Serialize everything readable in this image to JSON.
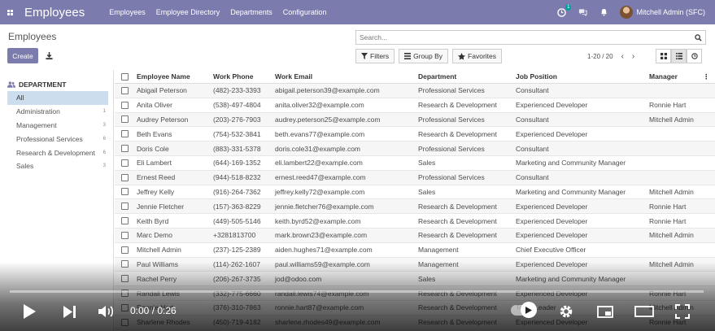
{
  "navbar": {
    "app_title": "Employees",
    "menu": [
      "Employees",
      "Employee Directory",
      "Departments",
      "Configuration"
    ],
    "activity_badge": "1",
    "user_name": "Mitchell Admin (SFC)",
    "accent_color": "#7c7bad"
  },
  "control_panel": {
    "title": "Employees",
    "create_label": "Create",
    "search_placeholder": "Search...",
    "filters_label": "Filters",
    "group_by_label": "Group By",
    "favorites_label": "Favorites",
    "pager": "1-20 / 20"
  },
  "sidebar": {
    "header": "DEPARTMENT",
    "items": [
      {
        "label": "All",
        "count": ""
      },
      {
        "label": "Administration",
        "count": "1"
      },
      {
        "label": "Management",
        "count": "3"
      },
      {
        "label": "Professional Services",
        "count": "6"
      },
      {
        "label": "Research & Development",
        "count": "6"
      },
      {
        "label": "Sales",
        "count": "3"
      }
    ]
  },
  "table": {
    "columns": [
      "Employee Name",
      "Work Phone",
      "Work Email",
      "Department",
      "Job Position",
      "Manager"
    ],
    "rows": [
      [
        "Abigail Peterson",
        "(482)-233-3393",
        "abigail.peterson39@example.com",
        "Professional Services",
        "Consultant",
        ""
      ],
      [
        "Anita Oliver",
        "(538)-497-4804",
        "anita.oliver32@example.com",
        "Research & Development",
        "Experienced Developer",
        "Ronnie Hart"
      ],
      [
        "Audrey Peterson",
        "(203)-276-7903",
        "audrey.peterson25@example.com",
        "Professional Services",
        "Consultant",
        "Mitchell Admin"
      ],
      [
        "Beth Evans",
        "(754)-532-3841",
        "beth.evans77@example.com",
        "Research & Development",
        "Experienced Developer",
        ""
      ],
      [
        "Doris Cole",
        "(883)-331-5378",
        "doris.cole31@example.com",
        "Professional Services",
        "Consultant",
        ""
      ],
      [
        "Eli Lambert",
        "(644)-169-1352",
        "eli.lambert22@example.com",
        "Sales",
        "Marketing and Community Manager",
        ""
      ],
      [
        "Ernest Reed",
        "(944)-518-8232",
        "ernest.reed47@example.com",
        "Professional Services",
        "Consultant",
        ""
      ],
      [
        "Jeffrey Kelly",
        "(916)-264-7362",
        "jeffrey.kelly72@example.com",
        "Sales",
        "Marketing and Community Manager",
        "Mitchell Admin"
      ],
      [
        "Jennie Fletcher",
        "(157)-363-8229",
        "jennie.fletcher76@example.com",
        "Research & Development",
        "Experienced Developer",
        "Ronnie Hart"
      ],
      [
        "Keith Byrd",
        "(449)-505-5146",
        "keith.byrd52@example.com",
        "Research & Development",
        "Experienced Developer",
        "Ronnie Hart"
      ],
      [
        "Marc Demo",
        "+3281813700",
        "mark.brown23@example.com",
        "Research & Development",
        "Experienced Developer",
        "Mitchell Admin"
      ],
      [
        "Mitchell Admin",
        "(237)-125-2389",
        "aiden.hughes71@example.com",
        "Management",
        "Chief Executive Officer",
        ""
      ],
      [
        "Paul Williams",
        "(114)-262-1607",
        "paul.williams59@example.com",
        "Management",
        "Experienced Developer",
        "Mitchell Admin"
      ],
      [
        "Rachel Perry",
        "(206)-267-3735",
        "jod@odoo.com",
        "Sales",
        "Marketing and Community Manager",
        ""
      ],
      [
        "Randall Lewis",
        "(332)-775-6660",
        "randall.lewis74@example.com",
        "Research & Development",
        "Experienced Developer",
        "Ronnie Hart"
      ],
      [
        "Ronnie Hart",
        "(376)-310-7863",
        "ronnie.hart87@example.com",
        "Research & Development",
        "Team Leader",
        "Mitchell Admin"
      ],
      [
        "Sharlene Rhodes",
        "(450)-719-4182",
        "sharlene.rhodes49@example.com",
        "Research & Development",
        "Experienced Developer",
        "Ronnie Hart"
      ]
    ]
  },
  "video": {
    "time": "0:00 / 0:26",
    "progress": 0
  }
}
